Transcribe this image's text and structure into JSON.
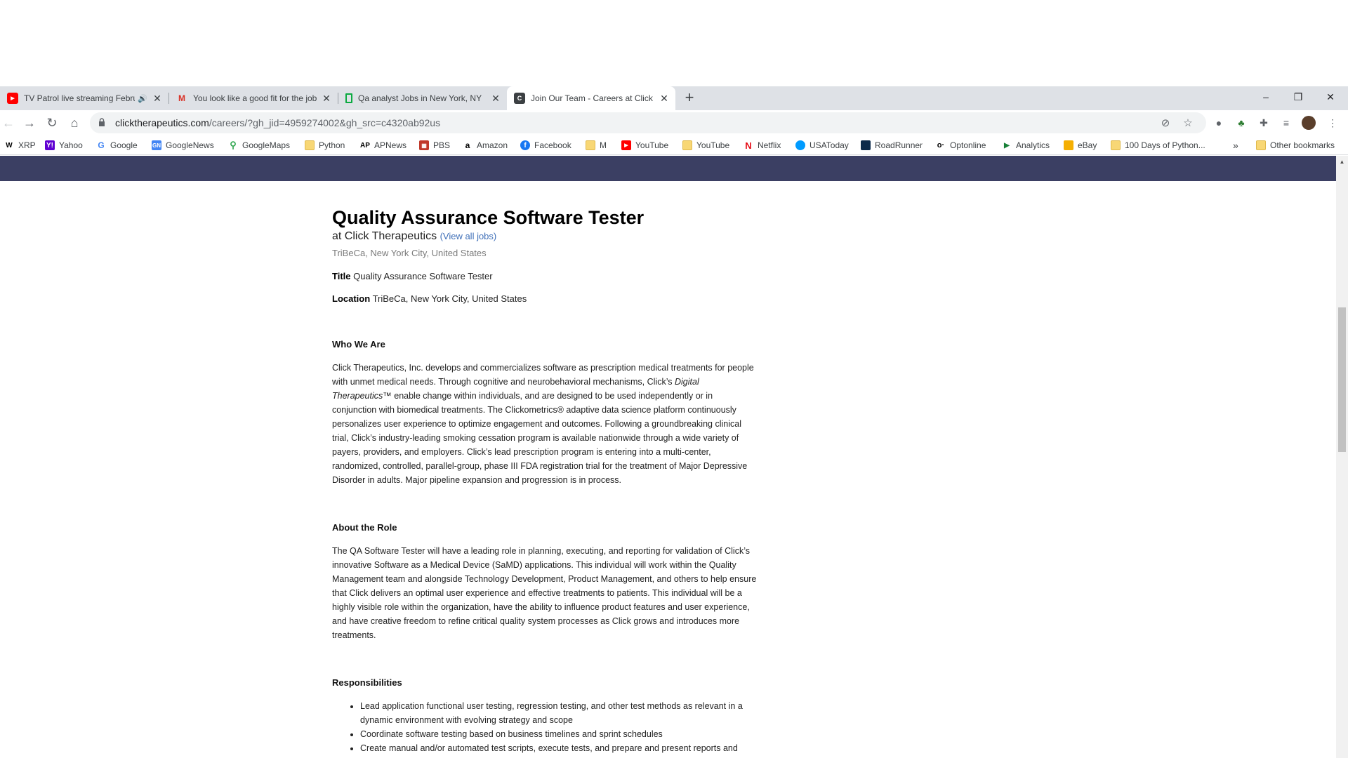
{
  "browser": {
    "tabs": [
      {
        "title": "TV Patrol live streaming February",
        "favicon": "youtube-icon",
        "audio": true
      },
      {
        "title": "You look like a good fit for the job",
        "favicon": "gmail-icon"
      },
      {
        "title": "Qa analyst Jobs in New York, NY",
        "favicon": "glassdoor-icon"
      },
      {
        "title": "Join Our Team - Careers at Click Therapeutics",
        "favicon": "click-icon",
        "active": true
      }
    ],
    "new_tab": "+",
    "window": {
      "minimize": "–",
      "restore": "❐",
      "close": "✕"
    },
    "url_host": "clicktherapeutics.com",
    "url_path": "/careers/?gh_jid=4959274002&gh_src=c4320ab92us",
    "bookmarks": [
      {
        "label": "XRP",
        "icon": "xrp-icon"
      },
      {
        "label": "Yahoo",
        "icon": "yahoo-icon"
      },
      {
        "label": "Google",
        "icon": "google-icon"
      },
      {
        "label": "GoogleNews",
        "icon": "google-news-icon"
      },
      {
        "label": "GoogleMaps",
        "icon": "google-maps-icon"
      },
      {
        "label": "Python",
        "icon": "folder-icon"
      },
      {
        "label": "APNews",
        "icon": "ap-icon"
      },
      {
        "label": "PBS",
        "icon": "pbs-icon"
      },
      {
        "label": "Amazon",
        "icon": "amazon-icon"
      },
      {
        "label": "Facebook",
        "icon": "facebook-icon"
      },
      {
        "label": "M",
        "icon": "folder-icon"
      },
      {
        "label": "YouTube",
        "icon": "youtube-icon"
      },
      {
        "label": "YouTube",
        "icon": "folder-icon"
      },
      {
        "label": "Netflix",
        "icon": "netflix-icon"
      },
      {
        "label": "USAToday",
        "icon": "usatoday-icon"
      },
      {
        "label": "RoadRunner",
        "icon": "roadrunner-icon"
      },
      {
        "label": "Optonline",
        "icon": "optonline-icon"
      },
      {
        "label": "Analytics",
        "icon": "analytics-icon"
      },
      {
        "label": "eBay",
        "icon": "ebay-icon"
      },
      {
        "label": "100 Days of Python...",
        "icon": "folder-icon"
      }
    ],
    "more_bookmarks": "»",
    "other_bookmarks": "Other bookmarks"
  },
  "job": {
    "title": "Quality Assurance Software Tester",
    "company_prefix": "at Click Therapeutics",
    "view_all": "(View all jobs)",
    "location": "TriBeCa, New York City, United States",
    "title_label": "Title",
    "title_value": "Quality Assurance Software Tester",
    "location_label": "Location",
    "location_value": "TriBeCa, New York City, United States",
    "who_heading": "Who We Are",
    "who_text_1": "Click Therapeutics, Inc. develops and commercializes software as prescription medical treatments for people with unmet medical needs. Through cognitive and neurobehavioral mechanisms, Click’s ",
    "who_text_em": "Digital Therapeutics",
    "who_text_2": "™ enable change within individuals, and are designed to be used independently or in conjunction with biomedical treatments. The Clickometrics® adaptive data science platform continuously personalizes user experience to optimize engagement and outcomes. Following a groundbreaking clinical trial, Click’s industry-leading smoking cessation program is available nationwide through a wide variety of payers, providers, and employers. Click’s lead prescription program is entering into a multi-center, randomized, controlled, parallel-group, phase III FDA registration trial for the treatment of Major Depressive Disorder in adults. Major pipeline expansion and progression is in process.",
    "role_heading": "About the Role",
    "role_text": "The QA Software Tester will have a leading role in planning, executing, and reporting for validation of Click’s innovative Software as a Medical Device (SaMD) applications. This individual will work within the Quality Management team and alongside Technology Development, Product Management, and others to help ensure that Click delivers an optimal user experience and effective treatments to patients. This individual will be a highly visible role within the organization, have the ability to influence product features and user experience, and have creative freedom to refine critical quality system processes as Click grows and introduces more treatments.",
    "resp_heading": "Responsibilities",
    "responsibilities": [
      "Lead application functional user testing, regression testing, and other test methods as relevant in a dynamic environment with evolving strategy and scope",
      "Coordinate software testing based on business timelines and sprint schedules",
      "Create manual and/or automated test scripts, execute tests, and prepare and present reports and metrics to interdisciplinary groups"
    ]
  },
  "colors": {
    "banner": "#3b3f63",
    "link": "#3f6fb8",
    "tabstrip": "#dee1e6"
  }
}
